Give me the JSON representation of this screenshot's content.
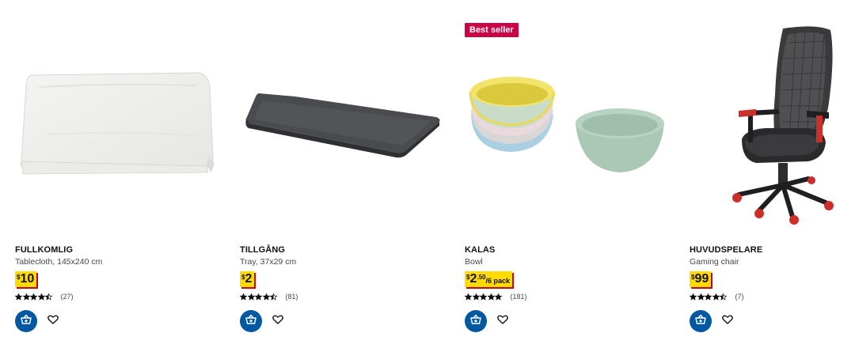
{
  "products": [
    {
      "name": "FULLKOMLIG",
      "description": "Tablecloth, 145x240 cm",
      "price": {
        "currency": "$",
        "integer": "10",
        "decimal": "",
        "unit": ""
      },
      "rating": {
        "stars": 4.5,
        "count": "(27)"
      },
      "badge": "",
      "icon": "tablecloth-image"
    },
    {
      "name": "TILLGÅNG",
      "description": "Tray, 37x29 cm",
      "price": {
        "currency": "$",
        "integer": "2",
        "decimal": "",
        "unit": ""
      },
      "rating": {
        "stars": 4.5,
        "count": "(81)"
      },
      "badge": "",
      "icon": "tray-image"
    },
    {
      "name": "KALAS",
      "description": "Bowl",
      "price": {
        "currency": "$",
        "integer": "2",
        "decimal": ".50",
        "unit": "/6 pack"
      },
      "rating": {
        "stars": 5,
        "count": "(181)"
      },
      "badge": "Best seller",
      "icon": "bowls-image"
    },
    {
      "name": "HUVUDSPELARE",
      "description": "Gaming chair",
      "price": {
        "currency": "$",
        "integer": "99",
        "decimal": "",
        "unit": ""
      },
      "rating": {
        "stars": 4.5,
        "count": "(7)"
      },
      "badge": "",
      "icon": "gaming-chair-image"
    }
  ],
  "colors": {
    "price_bg": "#ffdb00",
    "price_shadow": "#cc0008",
    "badge_bg": "#cc0045",
    "cart_button": "#0058a3",
    "text_secondary": "#484848"
  },
  "icons": {
    "cart_button": "add-to-cart-icon",
    "favourite_button": "heart-icon",
    "rating": "star-icon"
  }
}
